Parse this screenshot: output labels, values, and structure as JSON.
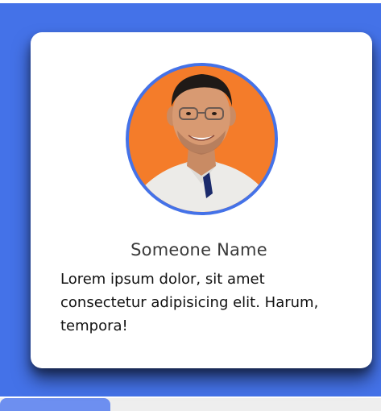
{
  "card": {
    "name": "Someone Name",
    "description": "Lorem ipsum dolor, sit amet consectetur adipisicing elit. Harum, tempora!"
  },
  "colors": {
    "accent": "#4472e8",
    "avatar_bg": "#f47c2a",
    "card_bg": "#ffffff"
  },
  "icons": {
    "avatar": "profile-photo"
  }
}
